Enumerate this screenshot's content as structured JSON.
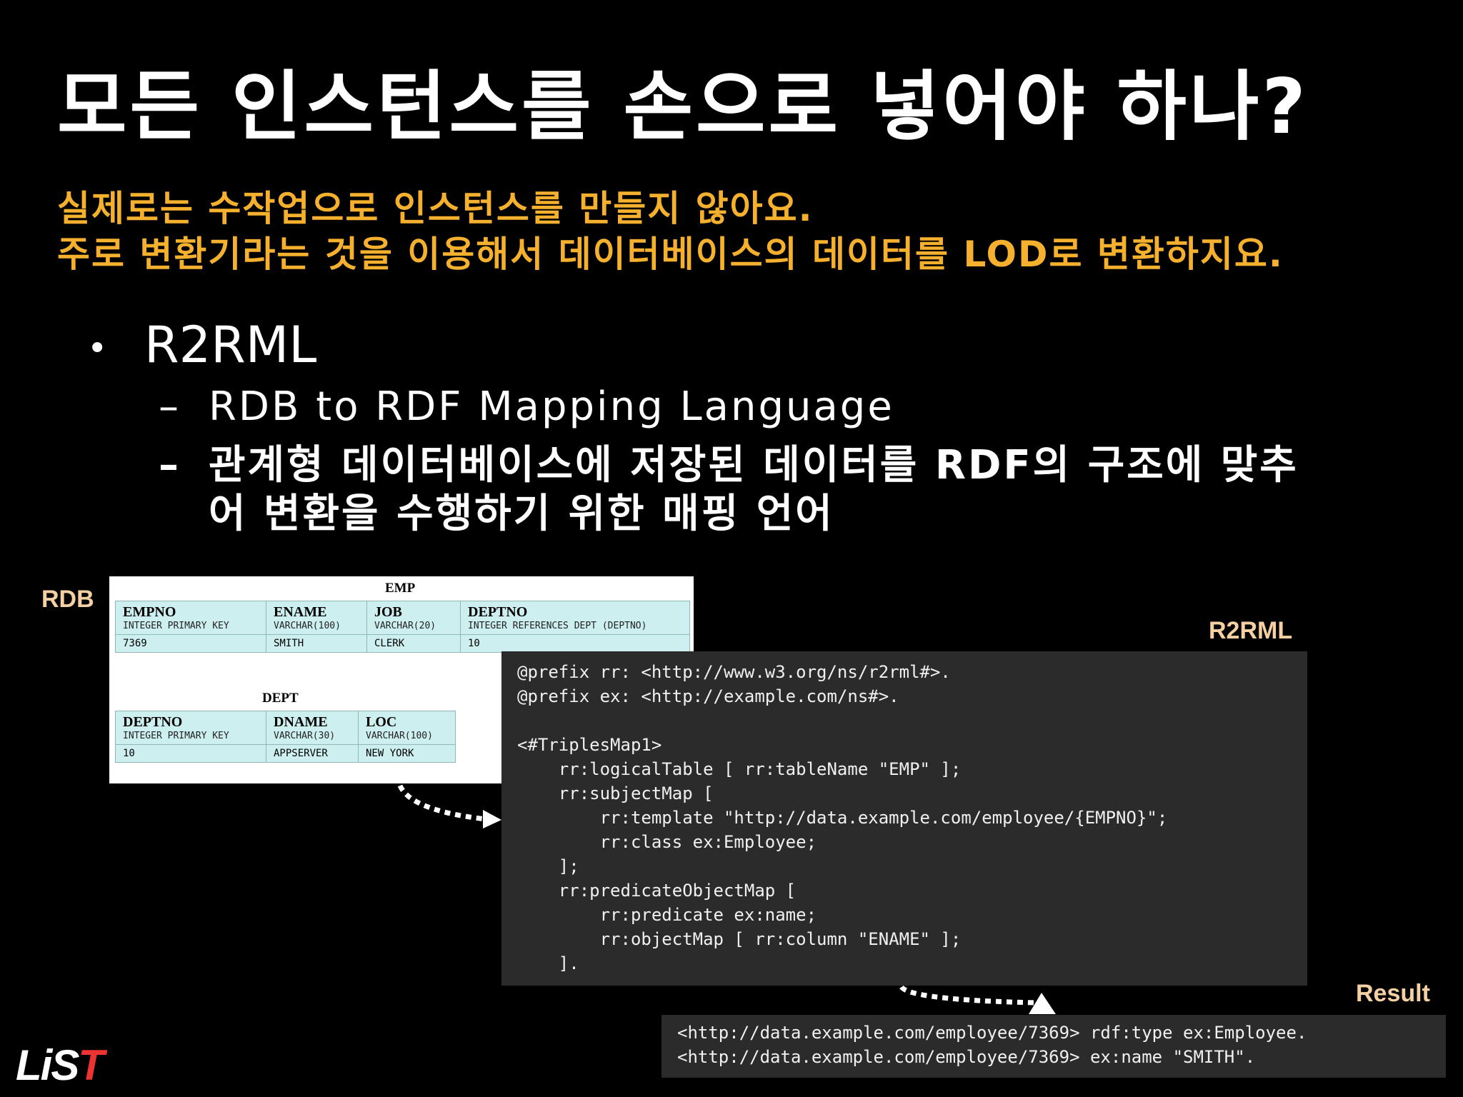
{
  "slide": {
    "title": "모든 인스턴스를 손으로 넣어야 하나?",
    "subtitle_lines": [
      "실제로는 수작업으로 인스턴스를 만들지 않아요.",
      "주로 변환기라는 것을 이용해서 데이터베이스의 데이터를 LOD로 변환하지요."
    ],
    "bullet": "R2RML",
    "subbullets": [
      "RDB to RDF Mapping Language",
      "관계형 데이터베이스에 저장된 데이터를 RDF의 구조에 맞추",
      "어 변환을 수행하기 위한 매핑 언어"
    ]
  },
  "labels": {
    "rdb": "RDB",
    "r2rml": "R2RML",
    "result": "Result"
  },
  "emp_table": {
    "title": "EMP",
    "columns": [
      {
        "name": "EMPNO",
        "type": "INTEGER PRIMARY KEY"
      },
      {
        "name": "ENAME",
        "type": "VARCHAR(100)"
      },
      {
        "name": "JOB",
        "type": "VARCHAR(20)"
      },
      {
        "name": "DEPTNO",
        "type": "INTEGER REFERENCES DEPT (DEPTNO)"
      }
    ],
    "row": [
      "7369",
      "SMITH",
      "CLERK",
      "10"
    ]
  },
  "dept_table": {
    "title": "DEPT",
    "columns": [
      {
        "name": "DEPTNO",
        "type": "INTEGER PRIMARY KEY"
      },
      {
        "name": "DNAME",
        "type": "VARCHAR(30)"
      },
      {
        "name": "LOC",
        "type": "VARCHAR(100)"
      }
    ],
    "row": [
      "10",
      "APPSERVER",
      "NEW YORK"
    ]
  },
  "r2rml_code": [
    "@prefix rr: <http://www.w3.org/ns/r2rml#>.",
    "@prefix ex: <http://example.com/ns#>.",
    "",
    "<#TriplesMap1>",
    "    rr:logicalTable [ rr:tableName \"EMP\" ];",
    "    rr:subjectMap [",
    "        rr:template \"http://data.example.com/employee/{EMPNO}\";",
    "        rr:class ex:Employee;",
    "    ];",
    "    rr:predicateObjectMap [",
    "        rr:predicate ex:name;",
    "        rr:objectMap [ rr:column \"ENAME\" ];",
    "    ]."
  ],
  "result_lines": [
    "<http://data.example.com/employee/7369> rdf:type ex:Employee.",
    "<http://data.example.com/employee/7369> ex:name \"SMITH\"."
  ],
  "logo": "LiST",
  "colors": {
    "background": "#000000",
    "highlight": "#f5b02e",
    "label": "#f5d0a3",
    "code_bg": "#2b2b2b",
    "table_bg": "#cdeff0"
  }
}
